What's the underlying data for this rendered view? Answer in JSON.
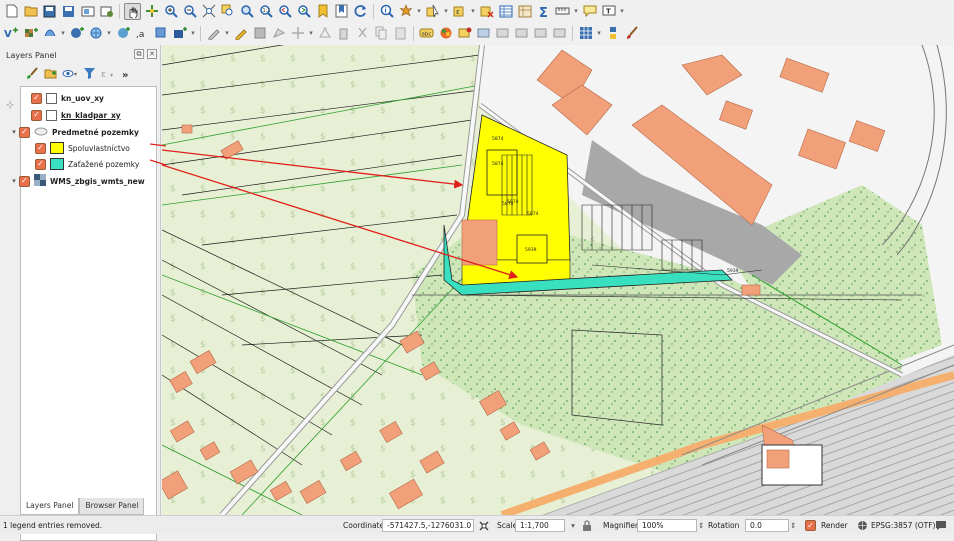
{
  "layers_panel": {
    "title": "Layers Panel",
    "layers": [
      {
        "name": "kn_uov_xy",
        "style": "bold"
      },
      {
        "name": "kn_kladpar_xy",
        "style": "underline"
      },
      {
        "name": "Predmetné pozemky",
        "style": "bold",
        "expanded": true,
        "children": [
          {
            "name": "Spoluvlastníctvo",
            "color": "#ffff00"
          },
          {
            "name": "Zaťažené pozemky",
            "color": "#38e0c0"
          }
        ]
      },
      {
        "name": "WMS_zbgis_wmts_new",
        "style": "bold"
      }
    ],
    "tabs": [
      "Layers Panel",
      "Browser Panel"
    ],
    "active_tab": "Layers Panel"
  },
  "map": {
    "parcel_labels": [
      "5874",
      "5874",
      "5874",
      "5874",
      "5874",
      "5939",
      "5939"
    ],
    "colors": {
      "fields": "#e7f0d4",
      "forest": "#cfe6b8",
      "buildings": "#f2a07a",
      "industrial": "#a8a8a8",
      "highlight_yellow": "#ffff00",
      "highlight_teal": "#38e0c0",
      "arrow": "#e0201a",
      "parcel_lines": "#1a1a1a",
      "cadastre_lines": "#2e9e2e"
    }
  },
  "statusbar": {
    "message": "1 legend entries removed.",
    "coordinate_label": "Coordinate",
    "coordinate_value": "-571427.5,-1276031.0",
    "scale_label": "Scale",
    "scale_value": "1:1,700",
    "magnifier_label": "Magnifier",
    "magnifier_value": "100%",
    "rotation_label": "Rotation",
    "rotation_value": "0.0",
    "render_label": "Render",
    "crs_label": "EPSG:3857 (OTF)"
  }
}
